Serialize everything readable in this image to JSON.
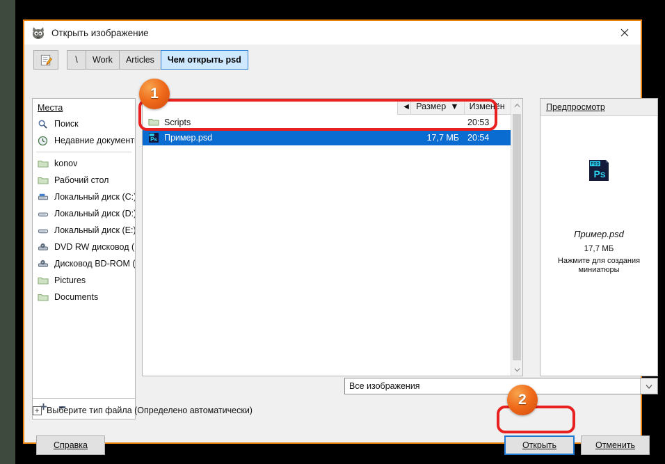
{
  "window": {
    "title": "Открыть изображение",
    "title_icon": "gimp-wilber-icon",
    "close_label": "✕"
  },
  "toolbar": {
    "edit_path_icon": "pencil-document-icon",
    "path_buttons": [
      {
        "label": "\\",
        "active": false
      },
      {
        "label": "Work",
        "active": false
      },
      {
        "label": "Articles",
        "active": false
      },
      {
        "label": "Чем открыть psd",
        "active": true
      }
    ]
  },
  "places": {
    "header": "Места",
    "items": [
      {
        "label": "Поиск",
        "icon": "search-icon"
      },
      {
        "label": "Недавние документы",
        "icon": "recent-clock-icon"
      },
      {
        "label": "konov",
        "icon": "folder-icon"
      },
      {
        "label": "Рабочий стол",
        "icon": "folder-icon"
      },
      {
        "label": "Локальный диск (C:)",
        "icon": "harddrive-system-icon"
      },
      {
        "label": "Локальный диск (D:)",
        "icon": "harddrive-icon"
      },
      {
        "label": "Локальный диск (E:)",
        "icon": "harddrive-icon"
      },
      {
        "label": "DVD RW дисковод (F:)",
        "icon": "optical-drive-icon"
      },
      {
        "label": "Дисковод BD-ROM (...",
        "icon": "optical-drive-icon"
      },
      {
        "label": "Pictures",
        "icon": "folder-icon"
      },
      {
        "label": "Documents",
        "icon": "folder-icon"
      }
    ],
    "add_icon": "plus-icon",
    "remove_icon": "minus-icon"
  },
  "filelist": {
    "columns": [
      {
        "label": "Размер",
        "sort_indicator": "▼"
      },
      {
        "label": "Изменён",
        "sort_indicator": "◄"
      }
    ],
    "left_arrow": "◄",
    "rows": [
      {
        "name": "Scripts",
        "icon": "folder-icon",
        "size": "",
        "date": "20:53",
        "selected": false,
        "clipped": true
      },
      {
        "name": "Пример.psd",
        "icon": "psd-file-icon",
        "size": "17,7 МБ",
        "date": "20:54",
        "selected": true,
        "clipped": false
      }
    ],
    "scrollbar": {
      "up": "⌃",
      "down": "⌄"
    }
  },
  "preview": {
    "header": "Предпросмотр",
    "file_icon": "psd-file-icon",
    "icon_badge_text": "PSD",
    "icon_app_text": "Ps",
    "filename": "Пример.psd",
    "filesize": "17,7 МБ",
    "hint": "Нажмите для создания миниатюры"
  },
  "filter": {
    "value": "Все изображения",
    "dropdown_icon": "chevron-down-icon"
  },
  "filetype_expander": {
    "expand_icon": "⊞",
    "label": "Выберите тип файла (Определено автоматически)"
  },
  "buttons": {
    "help": "Справка",
    "open": "Открыть",
    "cancel": "Отменить"
  },
  "annotations": {
    "badge_one": "1",
    "badge_two": "2",
    "highlight_color": "#e82020",
    "badge_color": "#ef6a1a"
  }
}
